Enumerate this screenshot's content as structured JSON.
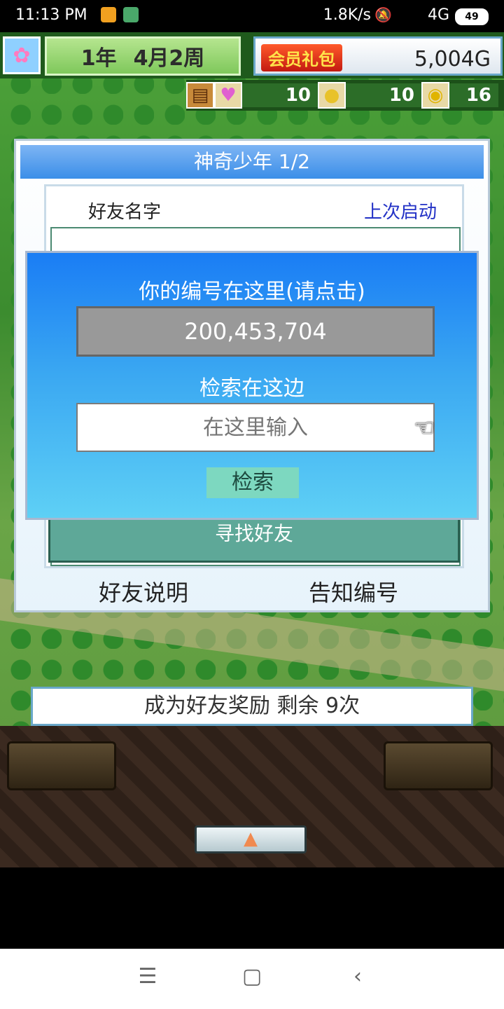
{
  "status_bar": {
    "time": "11:13 PM",
    "network_speed": "1.8K/s",
    "signal": "4G",
    "battery": "49"
  },
  "hud": {
    "date": {
      "year": "1年",
      "month_week": "4月2周"
    },
    "vip_label": "会员礼包",
    "gold": "5,004G",
    "resources": [
      {
        "icon": "heart-icon",
        "value": "10"
      },
      {
        "icon": "lightbulb-icon",
        "value": "10"
      },
      {
        "icon": "coin-icon",
        "value": "16"
      }
    ]
  },
  "friend_panel": {
    "title": "神奇少年 1/2",
    "column_name": "好友名字",
    "column_last_launch": "上次启动",
    "find_friend_button": "寻找好友",
    "friend_help": "好友说明",
    "tell_id": "告知编号"
  },
  "search_dialog": {
    "title": "你的编号在这里(请点击)",
    "player_id": "200,453,704",
    "search_label": "检索在这边",
    "input_placeholder": "在这里输入",
    "search_button": "检索"
  },
  "reward_bar": "成为好友奖励 剩余 9次",
  "nav": {
    "menu": "☰",
    "home": "▢",
    "back": "‹"
  }
}
